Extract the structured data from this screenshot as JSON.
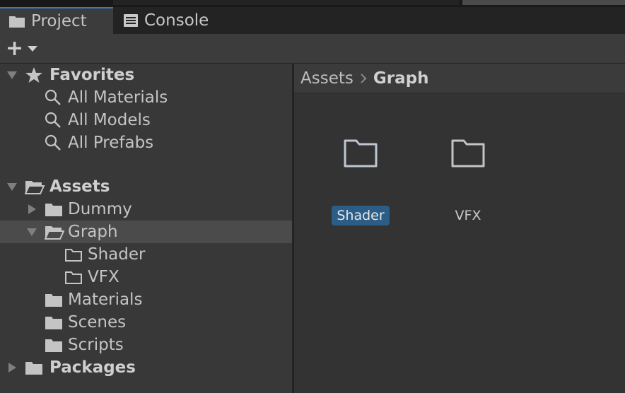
{
  "tabs": [
    {
      "label": "Project",
      "icon": "folder-icon",
      "active": true
    },
    {
      "label": "Console",
      "icon": "console-icon",
      "active": false
    }
  ],
  "toolbar": {
    "add_label": "+"
  },
  "tree": {
    "favorites": {
      "label": "Favorites",
      "items": [
        "All Materials",
        "All Models",
        "All Prefabs"
      ]
    },
    "assets": {
      "label": "Assets",
      "children": {
        "dummy": "Dummy",
        "graph": "Graph",
        "graph_children": [
          "Shader",
          "VFX"
        ],
        "materials": "Materials",
        "scenes": "Scenes",
        "scripts": "Scripts"
      }
    },
    "packages": {
      "label": "Packages"
    }
  },
  "breadcrumb": {
    "root": "Assets",
    "current": "Graph"
  },
  "content": {
    "items": [
      {
        "name": "Shader",
        "selected": true
      },
      {
        "name": "VFX",
        "selected": false
      }
    ]
  },
  "colors": {
    "accent": "#3a79bb",
    "selection": "#2c5d87",
    "tree_selected_row": "#4b4b4b"
  }
}
